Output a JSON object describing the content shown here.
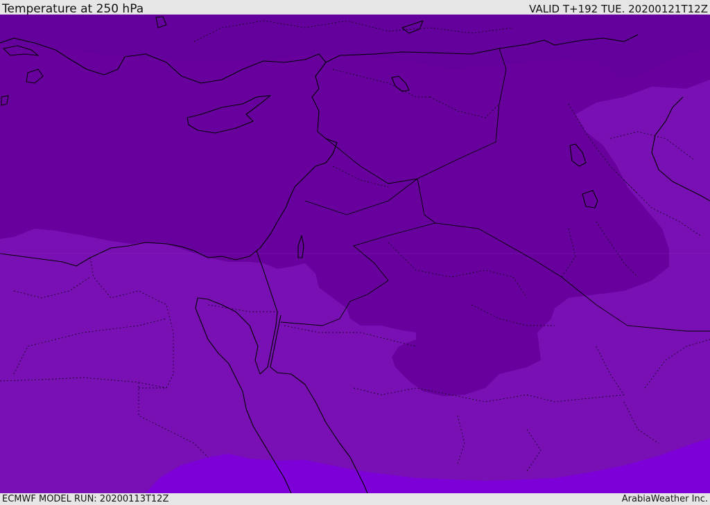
{
  "header": {
    "title": "Temperature at 250 hPa",
    "valid_time": "VALID T+192 TUE. 20200121T12Z"
  },
  "footer": {
    "model_run": "ECMWF MODEL RUN: 20200113T12Z",
    "credit": "ArabiaWeather Inc."
  },
  "map": {
    "colors": {
      "coldest": "#5f0092",
      "cold": "#68009e",
      "mid": "#7910b4",
      "warm": "#7d00d8",
      "border": "#000000"
    }
  }
}
